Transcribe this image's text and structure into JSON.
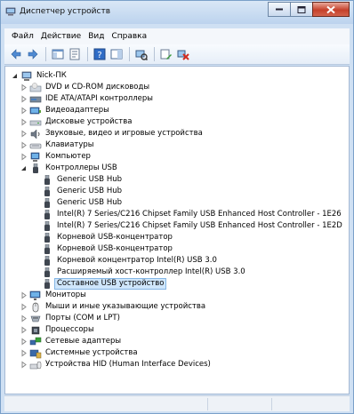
{
  "window": {
    "title": "Диспетчер устройств"
  },
  "menu": [
    "Файл",
    "Действие",
    "Вид",
    "Справка"
  ],
  "toolbar": {
    "buttons": [
      "back",
      "forward",
      "show-hide-console",
      "properties",
      "help",
      "action-pane",
      "scan-hardware-changes",
      "update-driver",
      "uninstall"
    ]
  },
  "tree": {
    "root": "Nick-ПК",
    "categories_top": [
      "DVD и CD-ROM дисководы",
      "IDE ATA/ATAPI контроллеры",
      "Видеоадаптеры",
      "Дисковые устройства",
      "Звуковые, видео и игровые устройства",
      "Клавиатуры",
      "Компьютер"
    ],
    "usb_category": "Контроллеры USB",
    "usb_children": [
      "Generic USB Hub",
      "Generic USB Hub",
      "Generic USB Hub",
      "Intel(R) 7 Series/C216 Chipset Family USB Enhanced Host Controller - 1E26",
      "Intel(R) 7 Series/C216 Chipset Family USB Enhanced Host Controller - 1E2D",
      "Корневой USB-концентратор",
      "Корневой USB-концентратор",
      "Корневой концентратор Intel(R) USB 3.0",
      "Расширяемый хост-контроллер Intel(R) USB 3.0",
      "Составное USB устройство"
    ],
    "selected_index": 9,
    "categories_bottom": [
      "Мониторы",
      "Мыши и иные указывающие устройства",
      "Порты (COM и LPT)",
      "Процессоры",
      "Сетевые адаптеры",
      "Системные устройства",
      "Устройства HID (Human Interface Devices)"
    ]
  },
  "colors": {
    "selection": "#cfe6fb",
    "selection_border": "#84b6e5",
    "frame": "#cfe0f3"
  }
}
